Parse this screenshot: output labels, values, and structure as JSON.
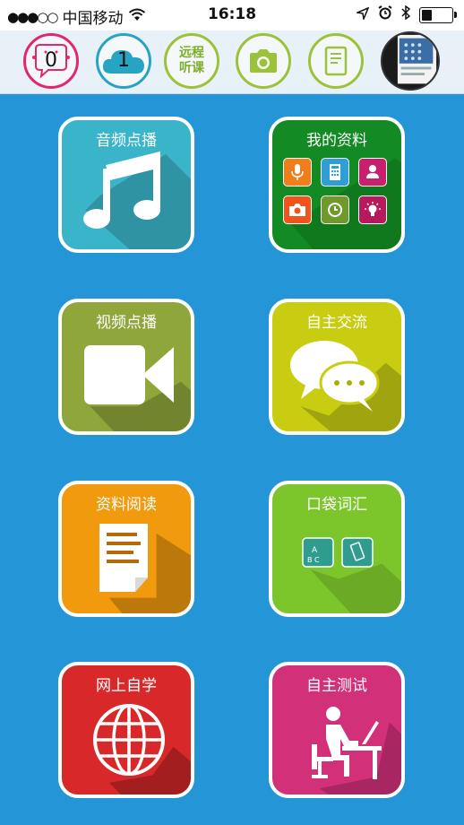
{
  "status_bar": {
    "signal_dots": "●●●○○",
    "carrier": "中国移动",
    "time": "16:18",
    "battery_level": 0.3
  },
  "toolbar": {
    "messages_count": "0",
    "cloud_count": "1",
    "remote_label_line1": "远程",
    "remote_label_line2": "听课"
  },
  "tiles": [
    {
      "label": "音频点播",
      "icon": "music-note-icon",
      "color": "#3ab4c8"
    },
    {
      "label": "我的资料",
      "icon": "my-data-grid-icon",
      "color": "#138a23"
    },
    {
      "label": "视频点播",
      "icon": "video-camera-icon",
      "color": "#8fa73a"
    },
    {
      "label": "自主交流",
      "icon": "chat-bubbles-icon",
      "color": "#c9cd12"
    },
    {
      "label": "资料阅读",
      "icon": "document-icon",
      "color": "#f19a0e"
    },
    {
      "label": "口袋词汇",
      "icon": "vocabulary-cards-icon",
      "color": "#7cc62c"
    },
    {
      "label": "网上自学",
      "icon": "globe-icon",
      "color": "#d8282a"
    },
    {
      "label": "自主测试",
      "icon": "person-at-desk-icon",
      "color": "#d3307a"
    }
  ],
  "colors": {
    "background": "#2495d6",
    "toolbar": "#e9f1f8",
    "pink_ring": "#e2266f",
    "blue_ring": "#27a4c4",
    "green_ring": "#9cc23a"
  }
}
